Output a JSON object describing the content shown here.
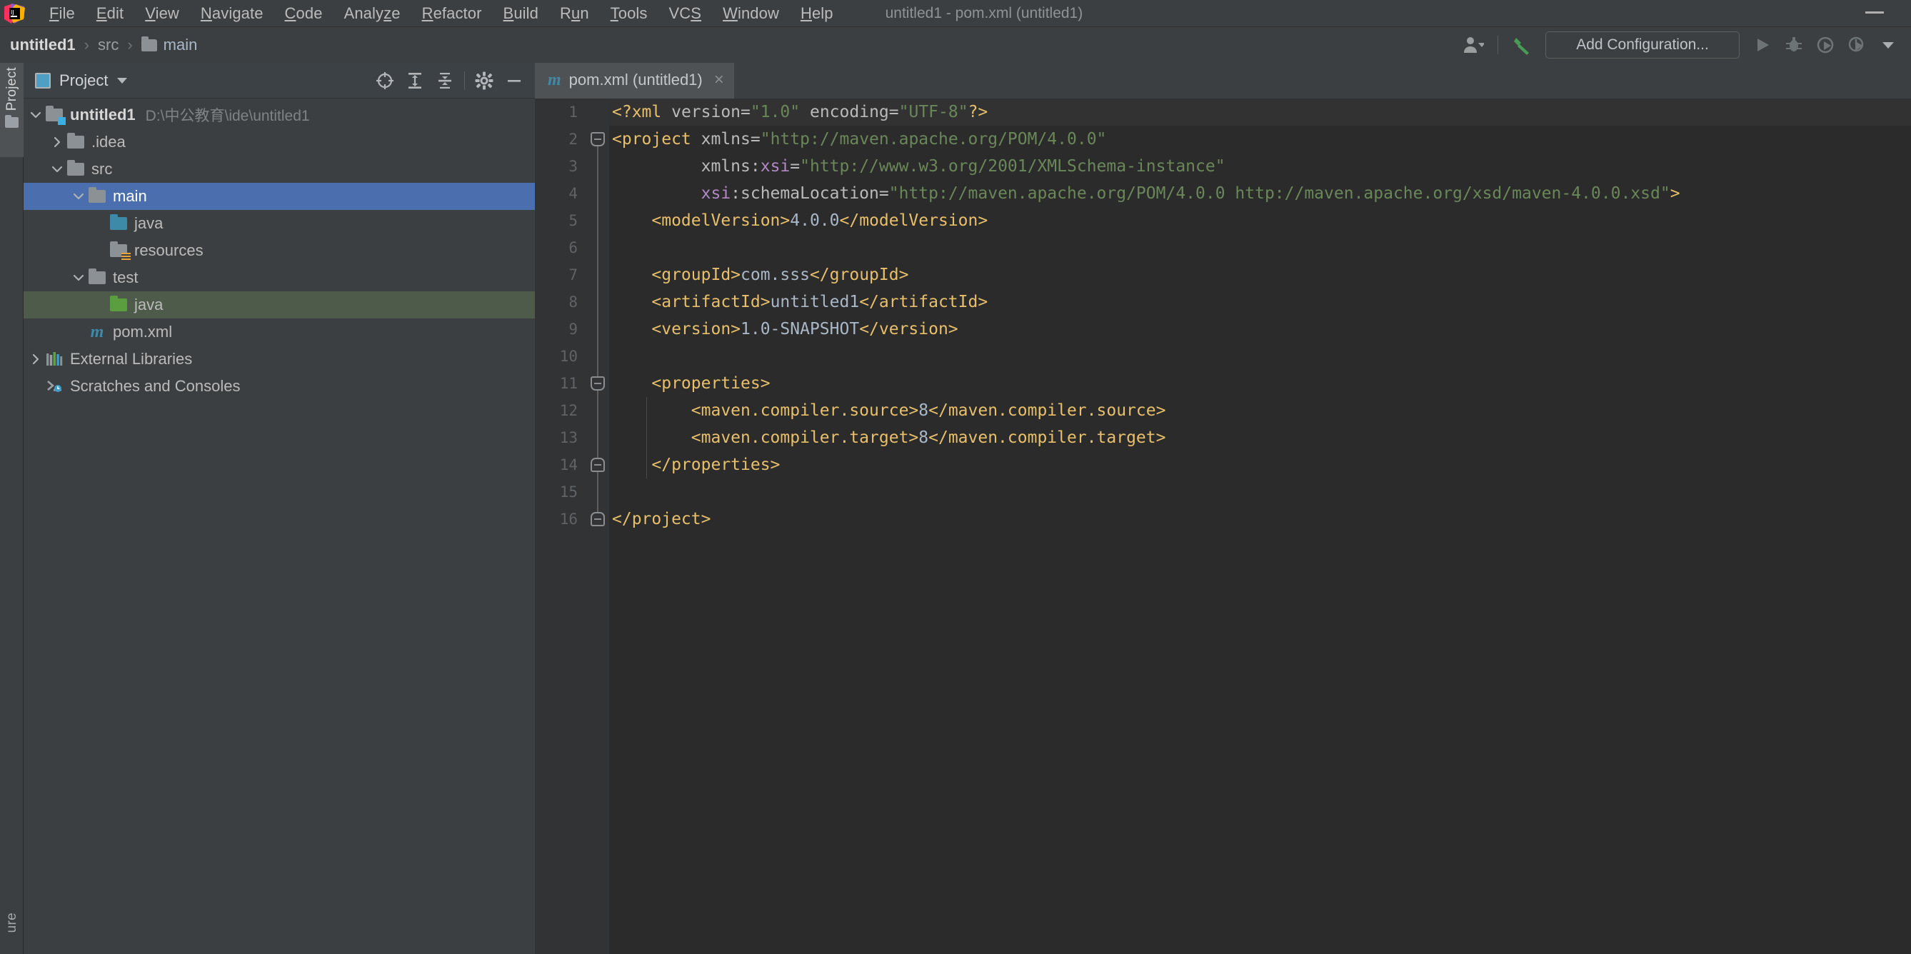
{
  "window": {
    "title": "untitled1 - pom.xml (untitled1)",
    "minimize_icon": "minimize-icon",
    "logo_icon": "intellij-idea-logo"
  },
  "menubar": {
    "items": [
      {
        "label": "File",
        "mnemonic": "F"
      },
      {
        "label": "Edit",
        "mnemonic": "E"
      },
      {
        "label": "View",
        "mnemonic": "V"
      },
      {
        "label": "Navigate",
        "mnemonic": "N"
      },
      {
        "label": "Code",
        "mnemonic": "C"
      },
      {
        "label": "Analyze",
        "mnemonic": "z"
      },
      {
        "label": "Refactor",
        "mnemonic": "R"
      },
      {
        "label": "Build",
        "mnemonic": "B"
      },
      {
        "label": "Run",
        "mnemonic": "u"
      },
      {
        "label": "Tools",
        "mnemonic": "T"
      },
      {
        "label": "VCS",
        "mnemonic": "S"
      },
      {
        "label": "Window",
        "mnemonic": "W"
      },
      {
        "label": "Help",
        "mnemonic": "H"
      }
    ]
  },
  "navbar": {
    "breadcrumbs": [
      {
        "label": "untitled1",
        "type": "project"
      },
      {
        "label": "src",
        "type": "folder-plain"
      },
      {
        "label": "main",
        "type": "folder"
      }
    ],
    "separator": "›"
  },
  "toolbar": {
    "account_icon": "user-account-icon",
    "account_caret": "chevron-down-icon",
    "hammer_icon": "build-hammer-icon",
    "add_configuration_label": "Add Configuration...",
    "run_icon": "run-play-icon",
    "debug_icon": "debug-bug-icon",
    "run_with_coverage_icon": "run-with-coverage-icon",
    "profile_icon": "profile-icon",
    "more_caret": "chevron-down-icon"
  },
  "tool_stripe": {
    "left_top": {
      "label": "Project",
      "icon": "project-folder-icon",
      "active": true
    },
    "left_bottom": {
      "label": "ure",
      "full_label": "Structure",
      "icon": "structure-icon"
    }
  },
  "project_panel": {
    "title": "Project",
    "title_icon": "project-view-icon",
    "title_caret": "chevron-down-icon",
    "tools": [
      {
        "name": "locate-icon",
        "label": "Select Opened File"
      },
      {
        "name": "expand-all-icon",
        "label": "Expand All"
      },
      {
        "name": "collapse-all-icon",
        "label": "Collapse All"
      },
      {
        "name": "gear-icon",
        "label": "Settings"
      },
      {
        "name": "minimize-icon",
        "label": "Hide"
      }
    ],
    "tree": [
      {
        "label": "untitled1",
        "sublabel": "D:\\中公教育\\ide\\untitled1",
        "depth": 0,
        "chevron": "down",
        "icon": "project-module-icon",
        "bold": true,
        "state": "normal"
      },
      {
        "label": ".idea",
        "sublabel": "",
        "depth": 1,
        "chevron": "right",
        "icon": "folder-icon",
        "bold": false,
        "state": "normal"
      },
      {
        "label": "src",
        "sublabel": "",
        "depth": 1,
        "chevron": "down",
        "icon": "folder-icon",
        "bold": false,
        "state": "normal"
      },
      {
        "label": "main",
        "sublabel": "",
        "depth": 2,
        "chevron": "down",
        "icon": "folder-icon",
        "bold": false,
        "state": "selected"
      },
      {
        "label": "java",
        "sublabel": "",
        "depth": 3,
        "chevron": "none",
        "icon": "source-root-folder-icon",
        "bold": false,
        "state": "normal"
      },
      {
        "label": "resources",
        "sublabel": "",
        "depth": 3,
        "chevron": "none",
        "icon": "resources-root-folder-icon",
        "bold": false,
        "state": "normal"
      },
      {
        "label": "test",
        "sublabel": "",
        "depth": 2,
        "chevron": "down",
        "icon": "folder-icon",
        "bold": false,
        "state": "normal"
      },
      {
        "label": "java",
        "sublabel": "",
        "depth": 3,
        "chevron": "none",
        "icon": "test-source-root-folder-icon",
        "bold": false,
        "state": "green-highlight"
      },
      {
        "label": "pom.xml",
        "sublabel": "",
        "depth": 2,
        "chevron": "none",
        "icon": "maven-pom-icon",
        "bold": false,
        "state": "normal"
      },
      {
        "label": "External Libraries",
        "sublabel": "",
        "depth": 0,
        "chevron": "right",
        "icon": "libraries-icon",
        "bold": false,
        "state": "normal"
      },
      {
        "label": "Scratches and Consoles",
        "sublabel": "",
        "depth": 0,
        "chevron": "none",
        "icon": "scratches-icon",
        "bold": false,
        "state": "normal"
      }
    ]
  },
  "editor": {
    "tabs": [
      {
        "label": "pom.xml (untitled1)",
        "icon": "maven-pom-icon",
        "close_icon": "close-icon",
        "active": true
      }
    ],
    "current_line": 1,
    "line_numbers": [
      1,
      2,
      3,
      4,
      5,
      6,
      7,
      8,
      9,
      10,
      11,
      12,
      13,
      14,
      15,
      16
    ],
    "lines": [
      {
        "n": 1,
        "tokens": [
          {
            "c": "t",
            "x": "<?xml "
          },
          {
            "c": "a",
            "x": "version"
          },
          {
            "c": "eq",
            "x": "="
          },
          {
            "c": "s",
            "x": "\"1.0\""
          },
          {
            "c": "a",
            "x": " encoding"
          },
          {
            "c": "eq",
            "x": "="
          },
          {
            "c": "s",
            "x": "\"UTF-8\""
          },
          {
            "c": "t",
            "x": "?>"
          }
        ]
      },
      {
        "n": 2,
        "tokens": [
          {
            "c": "t",
            "x": "<project"
          },
          {
            "c": "a",
            "x": " xmlns"
          },
          {
            "c": "eq",
            "x": "="
          },
          {
            "c": "s",
            "x": "\"http://maven.apache.org/POM/4.0.0\""
          }
        ]
      },
      {
        "n": 3,
        "tokens": [
          {
            "c": "a",
            "x": "         xmlns:"
          },
          {
            "c": "p",
            "x": "xsi"
          },
          {
            "c": "eq",
            "x": "="
          },
          {
            "c": "s",
            "x": "\"http://www.w3.org/2001/XMLSchema-instance\""
          }
        ]
      },
      {
        "n": 4,
        "tokens": [
          {
            "c": "p",
            "x": "         xsi"
          },
          {
            "c": "a",
            "x": ":schemaLocation"
          },
          {
            "c": "eq",
            "x": "="
          },
          {
            "c": "s",
            "x": "\"http://maven.apache.org/POM/4.0.0 http://maven.apache.org/xsd/maven-4.0.0.xsd\""
          },
          {
            "c": "t",
            "x": ">"
          }
        ]
      },
      {
        "n": 5,
        "tokens": [
          {
            "c": "t",
            "x": "    <modelVersion>"
          },
          {
            "c": "v",
            "x": "4.0.0"
          },
          {
            "c": "t",
            "x": "</modelVersion>"
          }
        ]
      },
      {
        "n": 6,
        "tokens": [
          {
            "c": "v",
            "x": ""
          }
        ]
      },
      {
        "n": 7,
        "tokens": [
          {
            "c": "t",
            "x": "    <groupId>"
          },
          {
            "c": "v",
            "x": "com.sss"
          },
          {
            "c": "t",
            "x": "</groupId>"
          }
        ]
      },
      {
        "n": 8,
        "tokens": [
          {
            "c": "t",
            "x": "    <artifactId>"
          },
          {
            "c": "v",
            "x": "untitled1"
          },
          {
            "c": "t",
            "x": "</artifactId>"
          }
        ]
      },
      {
        "n": 9,
        "tokens": [
          {
            "c": "t",
            "x": "    <version>"
          },
          {
            "c": "v",
            "x": "1.0-SNAPSHOT"
          },
          {
            "c": "t",
            "x": "</version>"
          }
        ]
      },
      {
        "n": 10,
        "tokens": [
          {
            "c": "v",
            "x": ""
          }
        ]
      },
      {
        "n": 11,
        "tokens": [
          {
            "c": "t",
            "x": "    <properties>"
          }
        ]
      },
      {
        "n": 12,
        "tokens": [
          {
            "c": "t",
            "x": "        <maven.compiler.source>"
          },
          {
            "c": "v",
            "x": "8"
          },
          {
            "c": "t",
            "x": "</maven.compiler.source>"
          }
        ]
      },
      {
        "n": 13,
        "tokens": [
          {
            "c": "t",
            "x": "        <maven.compiler.target>"
          },
          {
            "c": "v",
            "x": "8"
          },
          {
            "c": "t",
            "x": "</maven.compiler.target>"
          }
        ]
      },
      {
        "n": 14,
        "tokens": [
          {
            "c": "t",
            "x": "    </properties>"
          }
        ]
      },
      {
        "n": 15,
        "tokens": [
          {
            "c": "v",
            "x": ""
          }
        ]
      },
      {
        "n": 16,
        "tokens": [
          {
            "c": "t",
            "x": "</project>"
          }
        ]
      }
    ],
    "fold_markers": [
      {
        "line": 2,
        "kind": "start"
      },
      {
        "line": 11,
        "kind": "start"
      },
      {
        "line": 14,
        "kind": "end"
      },
      {
        "line": 16,
        "kind": "end"
      }
    ]
  },
  "colors": {
    "bg_panel": "#3c3f41",
    "bg_editor": "#2b2b2b",
    "bg_gutter": "#313335",
    "selection_blue": "#4b6eaf",
    "selection_green": "#4e5a4a",
    "tag_orange": "#e8bf6a",
    "string_green": "#6a8759",
    "prefix_purple": "#b389c5",
    "text_default": "#a9b7c6",
    "accent_green": "#499c54"
  }
}
